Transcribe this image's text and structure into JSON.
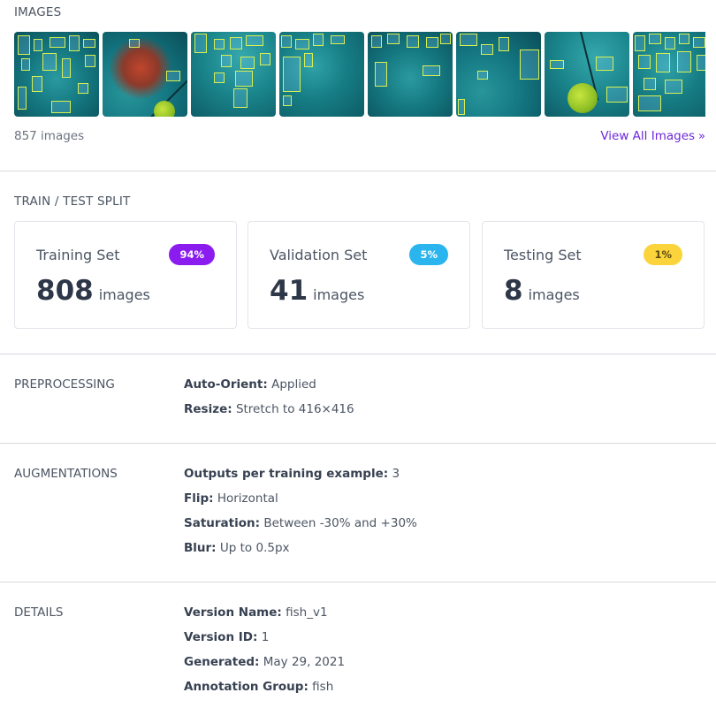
{
  "images": {
    "heading": "IMAGES",
    "count_text": "857 images",
    "view_all_label": "View All Images",
    "view_all_icon": "double-chevron-right-icon"
  },
  "split": {
    "heading": "TRAIN / TEST SPLIT",
    "cards": [
      {
        "name": "Training Set",
        "badge": "94%",
        "count": "808",
        "unit": "images",
        "badge_color": "#8b1cf0",
        "badge_text_color": "#ffffff"
      },
      {
        "name": "Validation Set",
        "badge": "5%",
        "count": "41",
        "unit": "images",
        "badge_color": "#2ab5ee",
        "badge_text_color": "#ffffff"
      },
      {
        "name": "Testing Set",
        "badge": "1%",
        "count": "8",
        "unit": "images",
        "badge_color": "#fbd43b",
        "badge_text_color": "#5b4a10"
      }
    ]
  },
  "preprocessing": {
    "heading": "PREPROCESSING",
    "items": [
      {
        "key": "Auto-Orient:",
        "value": "Applied"
      },
      {
        "key": "Resize:",
        "value": "Stretch to 416×416"
      }
    ]
  },
  "augmentations": {
    "heading": "AUGMENTATIONS",
    "items": [
      {
        "key": "Outputs per training example:",
        "value": "3"
      },
      {
        "key": "Flip:",
        "value": "Horizontal"
      },
      {
        "key": "Saturation:",
        "value": "Between -30% and +30%"
      },
      {
        "key": "Blur:",
        "value": "Up to 0.5px"
      }
    ]
  },
  "details": {
    "heading": "DETAILS",
    "items": [
      {
        "key": "Version Name:",
        "value": "fish_v1"
      },
      {
        "key": "Version ID:",
        "value": "1"
      },
      {
        "key": "Generated:",
        "value": "May 29, 2021"
      },
      {
        "key": "Annotation Group:",
        "value": "fish"
      }
    ]
  },
  "colors": {
    "accent": "#6d28d9",
    "annotation_box": "#d8ef52"
  }
}
